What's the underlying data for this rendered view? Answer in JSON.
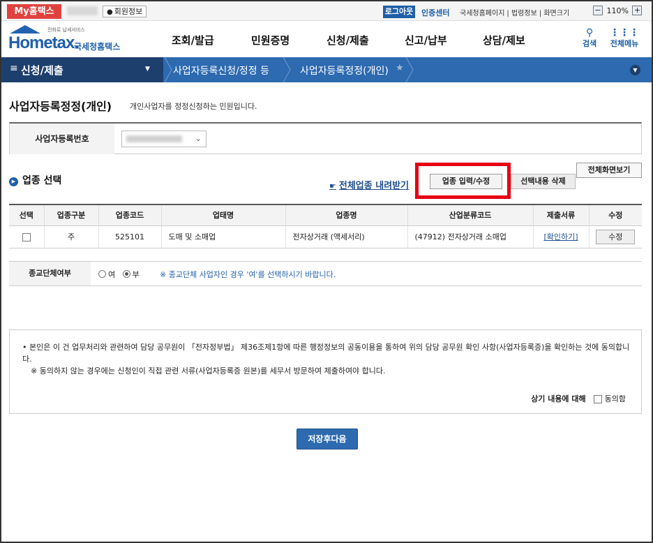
{
  "topbar": {
    "my_tab": "My홈택스",
    "member_info": "회원정보",
    "logout": "로그아웃",
    "auth_center": "인증센터",
    "links": [
      "국세청홈페이지",
      "법령정보",
      "화면크기"
    ],
    "zoom_minus": "−",
    "zoom_value": "110%",
    "zoom_plus": "+"
  },
  "header": {
    "logo_sub": "전화로 납세서비스",
    "logo_main": "Hometax.",
    "logo_kr": "국세청홈택스",
    "menu": [
      "조회/발급",
      "민원증명",
      "신청/제출",
      "신고/납부",
      "상담/제보"
    ],
    "search": "검색",
    "all_menu": "전체메뉴"
  },
  "nav": {
    "category": "신청/제출",
    "crumbs": [
      "사업자등록신청/정정 등",
      "사업자등록정정(개인)"
    ]
  },
  "page": {
    "title": "사업자등록정정(개인)",
    "desc": "개인사업자를 정정신청하는 민원입니다."
  },
  "reg": {
    "label": "사업자등록번호"
  },
  "section": {
    "title": "업종 선택",
    "full_view": "전체화면보기",
    "download": "전체업종 내려받기",
    "edit_btn": "업종 입력/수정",
    "delete_btn": "선택내용 삭제"
  },
  "table": {
    "headers": [
      "선택",
      "업종구분",
      "업종코드",
      "업태명",
      "업종명",
      "산업분류코드",
      "제출서류",
      "수정"
    ],
    "row": {
      "type": "주",
      "code": "525101",
      "business": "도매 및 소매업",
      "industry": "전자상거래 (액세서리)",
      "class_code": "(47912) 전자상거래 소매업",
      "docs": "[확인하기]",
      "edit": "수정"
    }
  },
  "religion": {
    "label": "종교단체여부",
    "yes": "여",
    "no": "부",
    "note": "※ 종교단체 사업자인 경우 '여'를 선택하시기 바랍니다."
  },
  "consent": {
    "p1": "• 본인은 이 건 업무처리와 관련하여 담당 공무원이 「전자정부법」 제36조제1항에 따른 행정정보의 공동이용을 통하여 위의 담당 공무원 확인 사항(사업자등록증)을 확인하는 것에 동의합니다.",
    "p2": "※  동의하지 않는 경우에는 신청인이 직접 관련 서류(사업자등록증 원본)를 세무서 방문하여 제출하여야 합니다.",
    "agree_label": "상기 내용에 대해",
    "agree_check": "동의함"
  },
  "save_button": "저장후다음",
  "colors": {
    "brand_blue": "#2d6ab0",
    "nav_dark": "#1d3f6d",
    "my_red": "#e0413e",
    "highlight": "#e60012"
  }
}
